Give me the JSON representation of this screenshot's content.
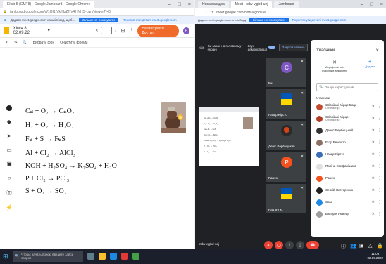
{
  "left_window": {
    "tab_title": "Ekstr 5 (GMT8) - Google Jamboard - Google Chrome",
    "url": "jamboard.google.com/d/1Qf1tVkfHzZf7vRHNHS-Lqrt/viewer?f=0",
    "infobar": {
      "text": "Додати meet.google.com на кліпборд, щоб...",
      "button": "Більше не показувати",
      "link": "Переглянути деталі meet.google.com"
    },
    "app": {
      "doc_title": "Хімія 8, 02.09.22",
      "frame_nav_prev": "‹",
      "frame_nav_next": "›",
      "share_button": "Налаштувати Доступ",
      "avatar_letter": "P"
    },
    "toolbar": {
      "undo": "↶",
      "redo": "↷",
      "zoom": "🔍",
      "set_background": "Вибрати фон",
      "clear_frame": "Очистити фрейм"
    },
    "equations": [
      "Ca + O₂ → CaO₂",
      "H₂ + O₂ → H₂O₂",
      "Fe + S → FeS",
      "Al + Cl₂ → AlCl₃",
      "KOH + H₂SO₄ → K₂SO₄ + H₂O",
      "P + Cl₂ → PCl₃",
      "S + O₂ → SO₂"
    ]
  },
  "right_window": {
    "tabs": [
      "Нова вкладка",
      "Meet - ndw-vjgbd-uej",
      "Jamboard"
    ],
    "url": "meet.google.com/ndw-vjgbd-uej",
    "infobar": {
      "text": "Додати meet.google.com на кліпборд",
      "button": "Більше не показувати",
      "link": "Переглянути деталі meet.google.com"
    },
    "presenting_notice": "Ви зараз на головному екрані",
    "toggle_label": "Звук демонстрації",
    "pin_button": "Закріпити вікно",
    "tiles": [
      {
        "name": "Ви",
        "initial": "C",
        "color": "#7e57c2"
      },
      {
        "name": "Назар Кірсто",
        "initial": "",
        "color": "#3b6db6"
      },
      {
        "name": "Деніс Вербицький",
        "initial": "",
        "color": "#333"
      },
      {
        "name": "Рамез",
        "initial": "P",
        "color": "#f4511e"
      },
      {
        "name": "Над 5-тих",
        "initial": "",
        "color": "#222"
      }
    ],
    "meeting_code": "ndw-vjgbd-uej",
    "participants_panel": {
      "title": "Учасники",
      "mute_all": "Мікрофони всіх учасників вимкнено",
      "add_people": "Додати",
      "search_placeholder": "Пошук користувачів",
      "section_label": "Учасники",
      "people": [
        {
          "name": "Стіснійші Мірце Ваце",
          "sub": "Організатор",
          "color": "#c64a2e"
        },
        {
          "name": "Стіснійші Мірце",
          "sub": "Організатор",
          "color": "#b33c25"
        },
        {
          "name": "Денис Вербицький",
          "sub": "",
          "color": "#333"
        },
        {
          "name": "Егор Бекешто",
          "sub": "",
          "color": "#8d6e63"
        },
        {
          "name": "Назар Кірсто",
          "sub": "",
          "color": "#3b6db6"
        },
        {
          "name": "Поліна Стефанішина",
          "sub": "",
          "color": "#e0e0e0"
        },
        {
          "name": "Рамез",
          "sub": "",
          "color": "#f4511e"
        },
        {
          "name": "Сергій Нестеренко",
          "sub": "",
          "color": "#222"
        },
        {
          "name": "Стас",
          "sub": "",
          "color": "#1e88e5"
        },
        {
          "name": "Вікторія Яківець",
          "sub": "",
          "color": "#9e9e9e"
        }
      ]
    }
  },
  "taskbar": {
    "search_placeholder": "Чтобы начать поиск, введите здесь запрос",
    "time": "11:08",
    "date": "02.09.2022"
  }
}
